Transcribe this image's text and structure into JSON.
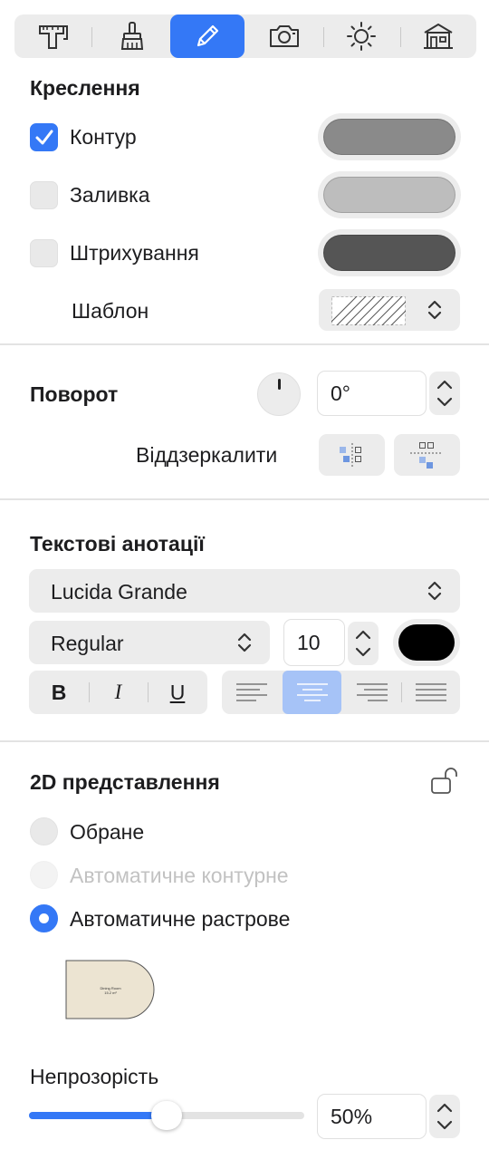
{
  "toolbar": {
    "tabs": [
      {
        "icon": "ruler-caliper-icon",
        "active": false
      },
      {
        "icon": "brush-icon",
        "active": false
      },
      {
        "icon": "pencil-icon",
        "active": true
      },
      {
        "icon": "camera-icon",
        "active": false
      },
      {
        "icon": "sun-icon",
        "active": false
      },
      {
        "icon": "building-icon",
        "active": false
      }
    ]
  },
  "drawing": {
    "title": "Креслення",
    "contour": {
      "label": "Контур",
      "checked": true,
      "color": "#8a8a8a"
    },
    "fill": {
      "label": "Заливка",
      "checked": false,
      "color": "#bdbdbd"
    },
    "hatch": {
      "label": "Штрихування",
      "checked": false,
      "color": "#555555"
    },
    "pattern": {
      "label": "Шаблон"
    }
  },
  "rotation": {
    "title": "Поворот",
    "value": "0°",
    "mirror_label": "Віддзеркалити"
  },
  "text": {
    "title": "Текстові анотації",
    "font": "Lucida Grande",
    "style": "Regular",
    "size": "10",
    "color": "#000000",
    "bold": "B",
    "italic": "I",
    "underline": "U",
    "alignment_selected": "center"
  },
  "representation": {
    "title": "2D представлення",
    "options": [
      {
        "label": "Обране",
        "state": "off"
      },
      {
        "label": "Автоматичне контурне",
        "state": "disabled"
      },
      {
        "label": "Автоматичне растрове",
        "state": "on"
      }
    ],
    "thumb_text_1": "Dining Room",
    "thumb_text_2": "15.2 m²"
  },
  "opacity": {
    "label": "Непрозорість",
    "value": "50%",
    "fraction": 0.5
  }
}
